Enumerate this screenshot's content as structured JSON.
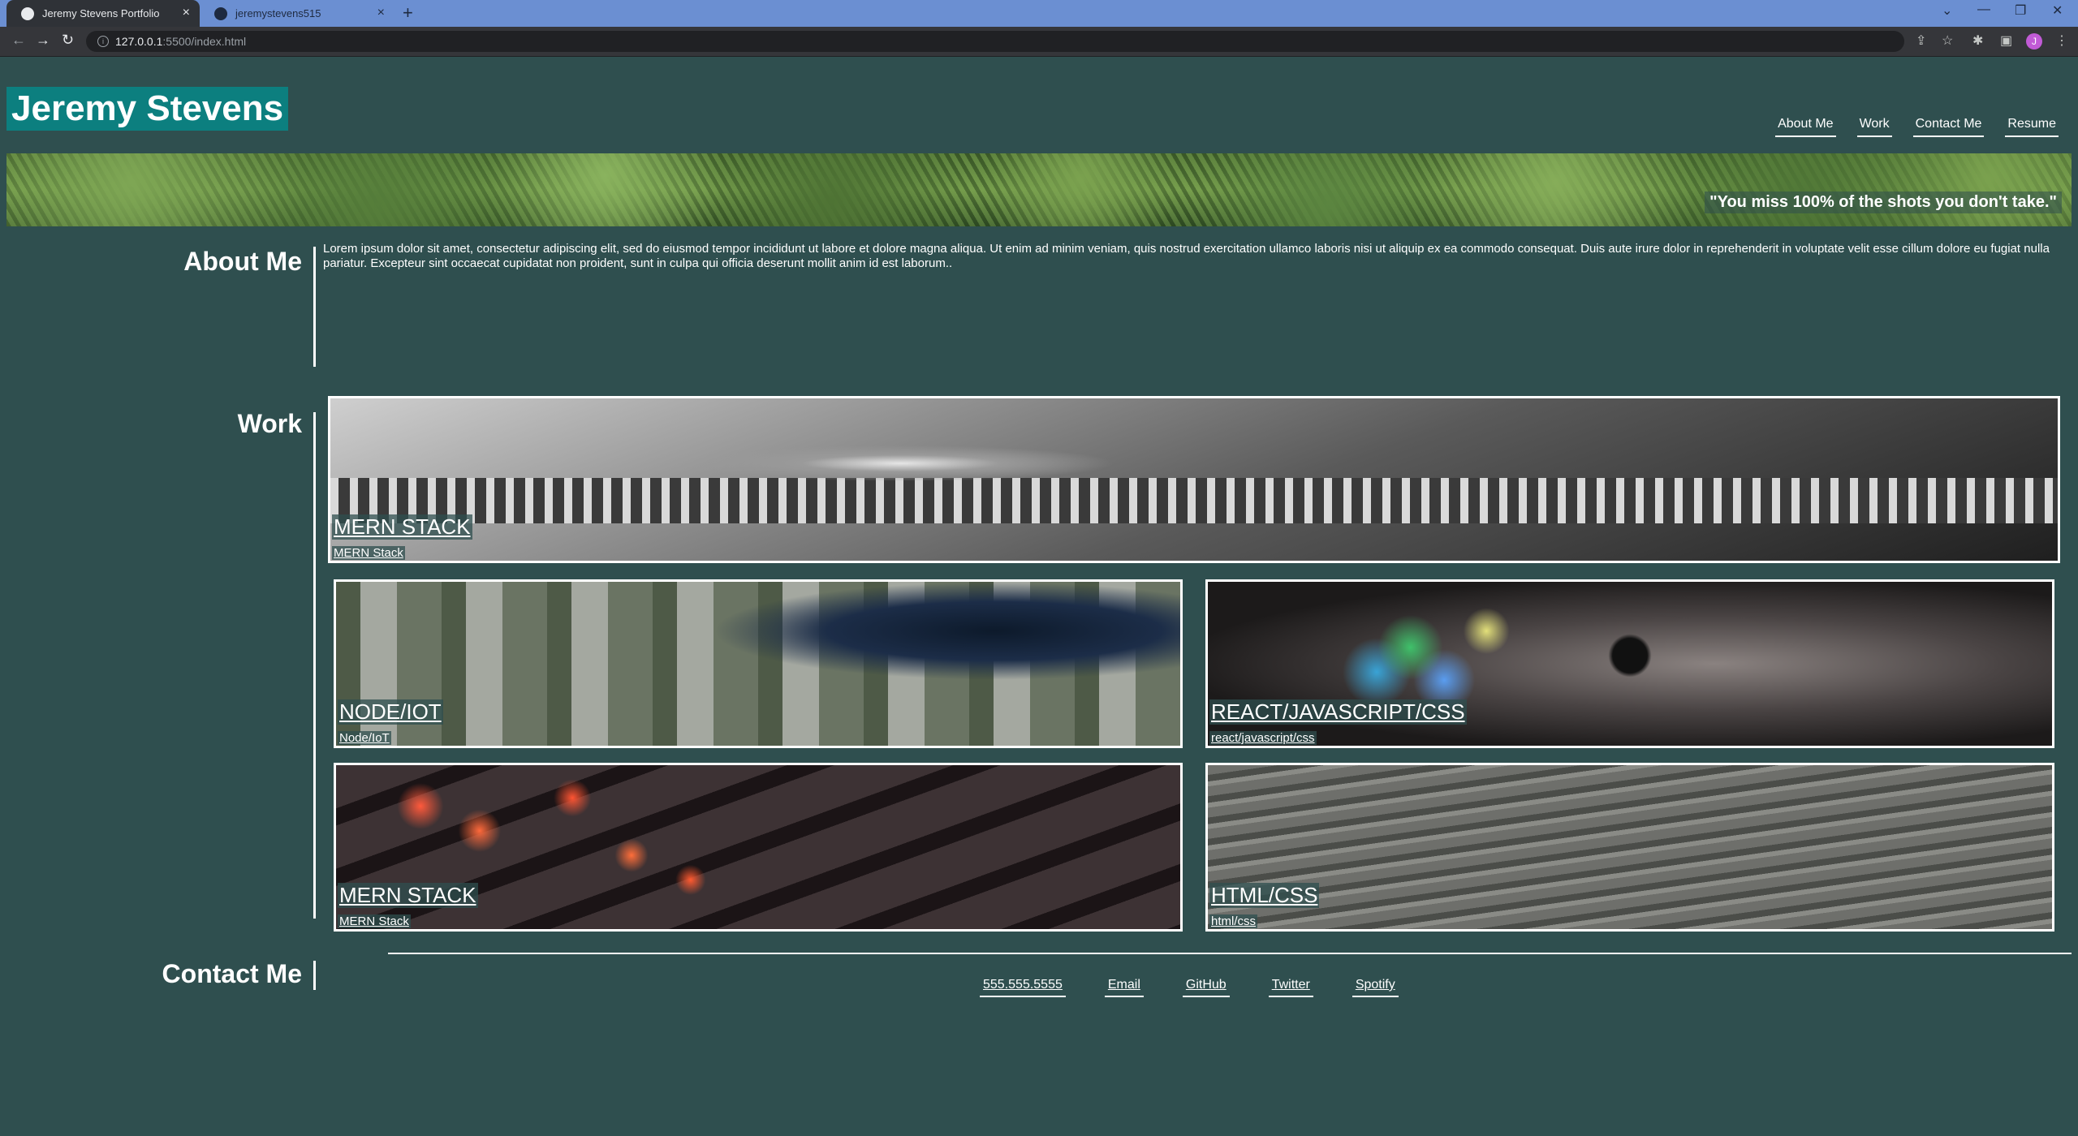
{
  "browser": {
    "tabs": [
      {
        "label": "Jeremy Stevens Portfolio",
        "active": true
      },
      {
        "label": "jeremystevens515",
        "active": false
      }
    ],
    "new_tab": "+",
    "window_controls": [
      "⌄",
      "—",
      "❐",
      "✕"
    ],
    "url_host": "127.0.0.1",
    "url_rest": ":5500/index.html",
    "profile_initial": "J"
  },
  "site": {
    "title": "Jeremy Stevens",
    "nav": [
      "About Me",
      "Work",
      "Contact Me",
      "Resume"
    ],
    "quote": "\"You miss 100% of the shots you don't take.\""
  },
  "about": {
    "heading": "About Me",
    "text": "Lorem ipsum dolor sit amet, consectetur adipiscing elit, sed do eiusmod tempor incididunt ut labore et dolore magna aliqua. Ut enim ad minim veniam, quis nostrud exercitation ullamco laboris nisi ut aliquip ex ea commodo consequat. Duis aute irure dolor in reprehenderit in voluptate velit esse cillum dolore eu fugiat nulla pariatur. Excepteur sint occaecat cupidatat non proident, sunt in culpa qui officia deserunt mollit anim id est laborum.."
  },
  "work": {
    "heading": "Work",
    "projects": [
      {
        "title": "MERN STACK",
        "subtitle": "MERN Stack"
      },
      {
        "title": "NODE/IOT",
        "subtitle": "Node/IoT"
      },
      {
        "title": "REACT/JAVASCRIPT/CSS",
        "subtitle": "react/javascript/css"
      },
      {
        "title": "MERN STACK",
        "subtitle": "MERN Stack"
      },
      {
        "title": "HTML/CSS",
        "subtitle": "html/css"
      }
    ]
  },
  "contact": {
    "heading": "Contact Me",
    "links": [
      "555.555.5555",
      "Email",
      "GitHub",
      "Twitter",
      "Spotify"
    ]
  }
}
